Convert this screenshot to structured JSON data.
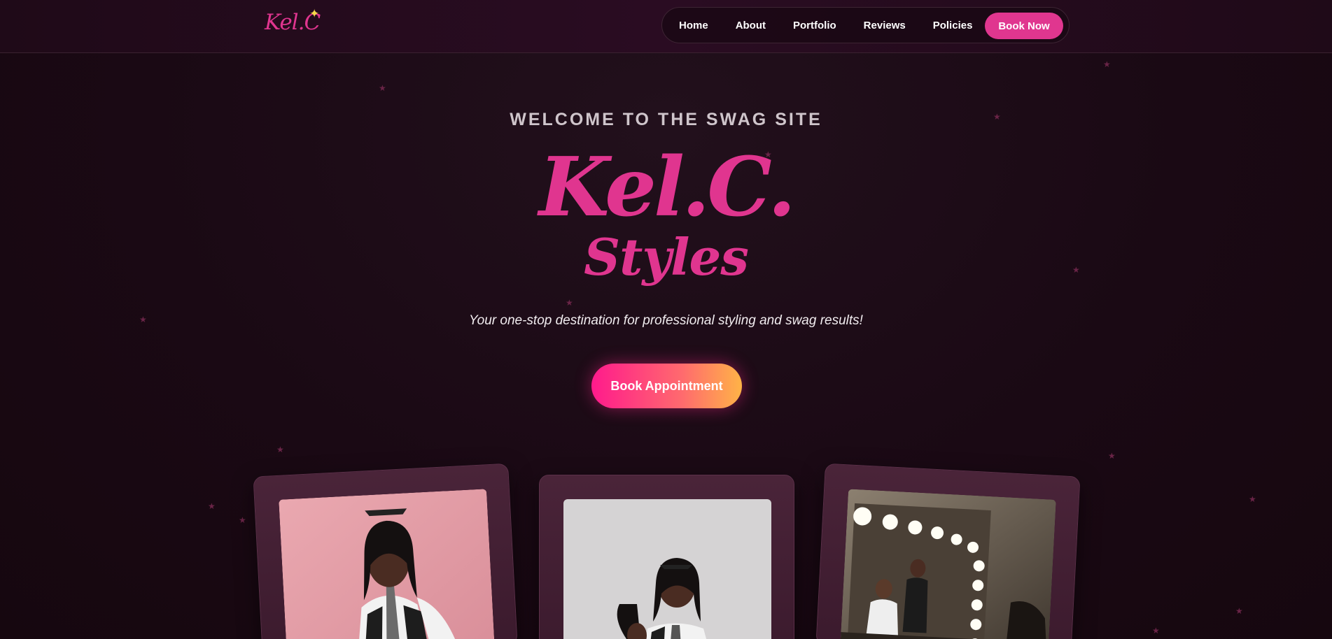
{
  "header": {
    "logo": "Kel.C",
    "nav": [
      "Home",
      "About",
      "Portfolio",
      "Reviews",
      "Policies"
    ],
    "book_now": "Book Now"
  },
  "hero": {
    "welcome": "WELCOME TO THE SWAG SITE",
    "brand": "Kel.C.",
    "brand_sub": "Styles",
    "tagline": "Your one-stop destination for professional styling and swag results!",
    "cta": "Book Appointment"
  },
  "gallery": {
    "photos": [
      "photo-pink-backdrop",
      "photo-gray-backdrop",
      "photo-vanity-mirror"
    ]
  },
  "colors": {
    "accent": "#e0358f",
    "background": "#1a0914",
    "card": "#4a2439"
  }
}
